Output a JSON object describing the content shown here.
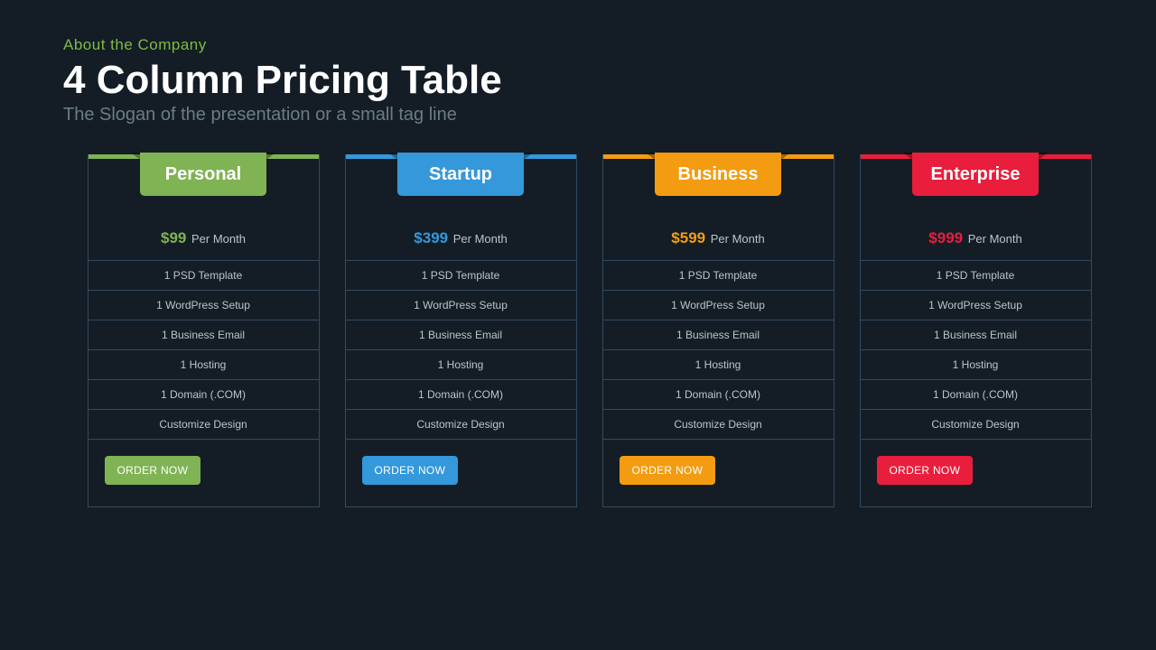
{
  "header": {
    "overline": "About the Company",
    "title": "4 Column Pricing Table",
    "subtitle": "The Slogan of the presentation or a small tag line"
  },
  "common": {
    "per": "Per Month",
    "features": [
      "1 PSD Template",
      "1 WordPress Setup",
      "1 Business Email",
      "1 Hosting",
      "1 Domain (.COM)",
      "Customize Design"
    ],
    "cta": "ORDER NOW"
  },
  "plans": [
    {
      "name": "Personal",
      "price": "$99",
      "color": "#7fb354"
    },
    {
      "name": "Startup",
      "price": "$399",
      "color": "#3498db"
    },
    {
      "name": "Business",
      "price": "$599",
      "color": "#f39c12"
    },
    {
      "name": "Enterprise",
      "price": "$999",
      "color": "#e91e3c"
    }
  ]
}
